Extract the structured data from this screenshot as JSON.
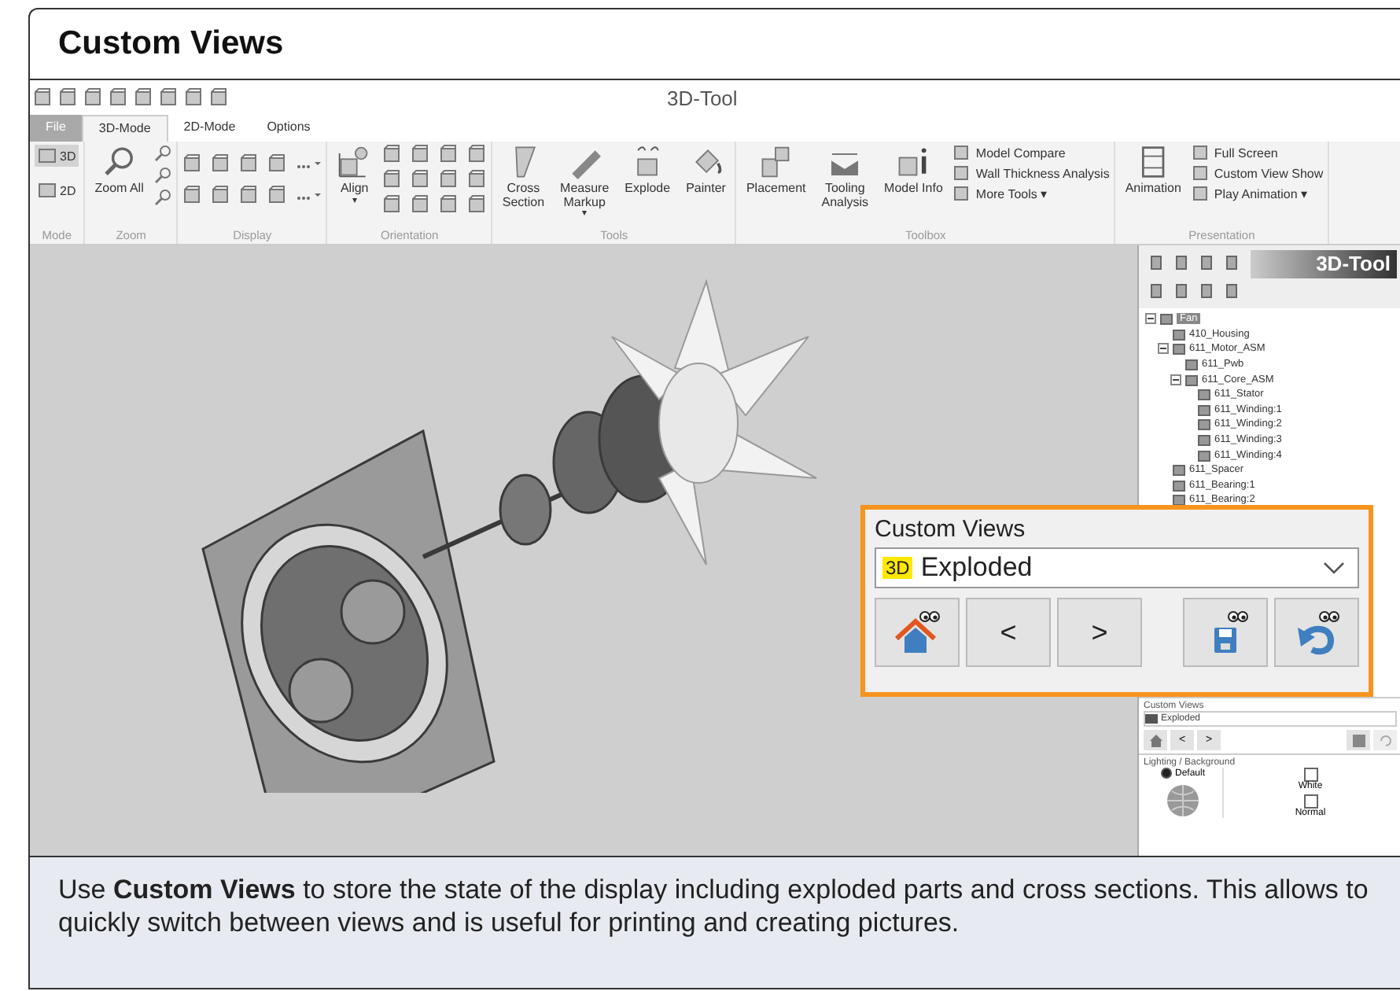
{
  "header": {
    "title": "Custom Views"
  },
  "app": {
    "window_title": "3D-Tool",
    "tabs": [
      {
        "label": "File",
        "kind": "file",
        "selected": false
      },
      {
        "label": "3D-Mode",
        "kind": "tab",
        "selected": true
      },
      {
        "label": "2D-Mode",
        "kind": "tab",
        "selected": false
      },
      {
        "label": "Options",
        "kind": "tab",
        "selected": false
      }
    ],
    "ribbon": [
      {
        "label": "Mode",
        "items": [
          {
            "kind": "mode",
            "label": "3D",
            "selected": true
          },
          {
            "kind": "mode",
            "label": "2D",
            "selected": false
          }
        ]
      },
      {
        "label": "Zoom",
        "items": [
          {
            "kind": "large",
            "lines": [
              "Zoom All"
            ]
          },
          {
            "kind": "iconcol"
          }
        ]
      },
      {
        "label": "Display",
        "items": [
          {
            "kind": "icongrid"
          }
        ]
      },
      {
        "label": "Orientation",
        "items": [
          {
            "kind": "large",
            "lines": [
              "Align"
            ],
            "caret": "▾"
          },
          {
            "kind": "icongrid2"
          }
        ]
      },
      {
        "label": "Tools",
        "items": [
          {
            "kind": "large",
            "lines": [
              "Cross",
              "Section"
            ]
          },
          {
            "kind": "large",
            "lines": [
              "Measure",
              "Markup"
            ],
            "caret": "▾"
          },
          {
            "kind": "large",
            "lines": [
              "Explode"
            ]
          },
          {
            "kind": "large",
            "lines": [
              "Painter"
            ]
          }
        ]
      },
      {
        "label": "Toolbox",
        "items": [
          {
            "kind": "large",
            "lines": [
              "Placement"
            ]
          },
          {
            "kind": "large",
            "lines": [
              "Tooling",
              "Analysis"
            ]
          },
          {
            "kind": "large",
            "lines": [
              "Model Info"
            ]
          },
          {
            "kind": "list",
            "entries": [
              {
                "label": "Model Compare"
              },
              {
                "label": "Wall Thickness Analysis"
              },
              {
                "label": "More Tools",
                "caret": "▾"
              }
            ]
          }
        ]
      },
      {
        "label": "Presentation",
        "items": [
          {
            "kind": "large",
            "lines": [
              "Animation"
            ]
          },
          {
            "kind": "list",
            "entries": [
              {
                "label": "Full Screen"
              },
              {
                "label": "Custom View Show"
              },
              {
                "label": "Play Animation",
                "caret": "▾"
              }
            ]
          }
        ]
      }
    ],
    "side_panel": {
      "logo_text": "3D-Tool",
      "tree": [
        {
          "label": "Fan",
          "selected": true,
          "expanded": true,
          "children": [
            {
              "label": "410_Housing",
              "selected": false
            },
            {
              "label": "611_Motor_ASM",
              "selected": false,
              "expanded": true,
              "children": [
                {
                  "label": "611_Pwb",
                  "selected": false
                },
                {
                  "label": "611_Core_ASM",
                  "selected": false,
                  "expanded": true,
                  "children": [
                    {
                      "label": "611_Stator",
                      "selected": false
                    },
                    {
                      "label": "611_Winding:1",
                      "selected": false
                    },
                    {
                      "label": "611_Winding:2",
                      "selected": false
                    },
                    {
                      "label": "611_Winding:3",
                      "selected": false
                    },
                    {
                      "label": "611_Winding:4",
                      "selected": false
                    }
                  ]
                }
              ]
            },
            {
              "label": "611_Spacer",
              "selected": false
            },
            {
              "label": "611_Bearing:1",
              "selected": false
            },
            {
              "label": "611_Bearing:2",
              "selected": false
            }
          ]
        }
      ],
      "custom_views": {
        "label": "Custom Views",
        "value": "Exploded",
        "prev": "<",
        "next": ">"
      },
      "lighting": {
        "label": "Lighting / Background",
        "options": [
          {
            "label": "Default",
            "selected": true
          }
        ],
        "checks": [
          {
            "label": "White",
            "checked": false
          },
          {
            "label": "Normal",
            "checked": false
          }
        ]
      }
    },
    "callout": {
      "label": "Custom Views",
      "badge": "3D",
      "value": "Exploded",
      "prev": "<",
      "next": ">"
    }
  },
  "caption": "Use **Custom Views** to store the state of the display including exploded parts and cross sections. This allows to quickly switch between views and is useful for printing and creating pictures."
}
